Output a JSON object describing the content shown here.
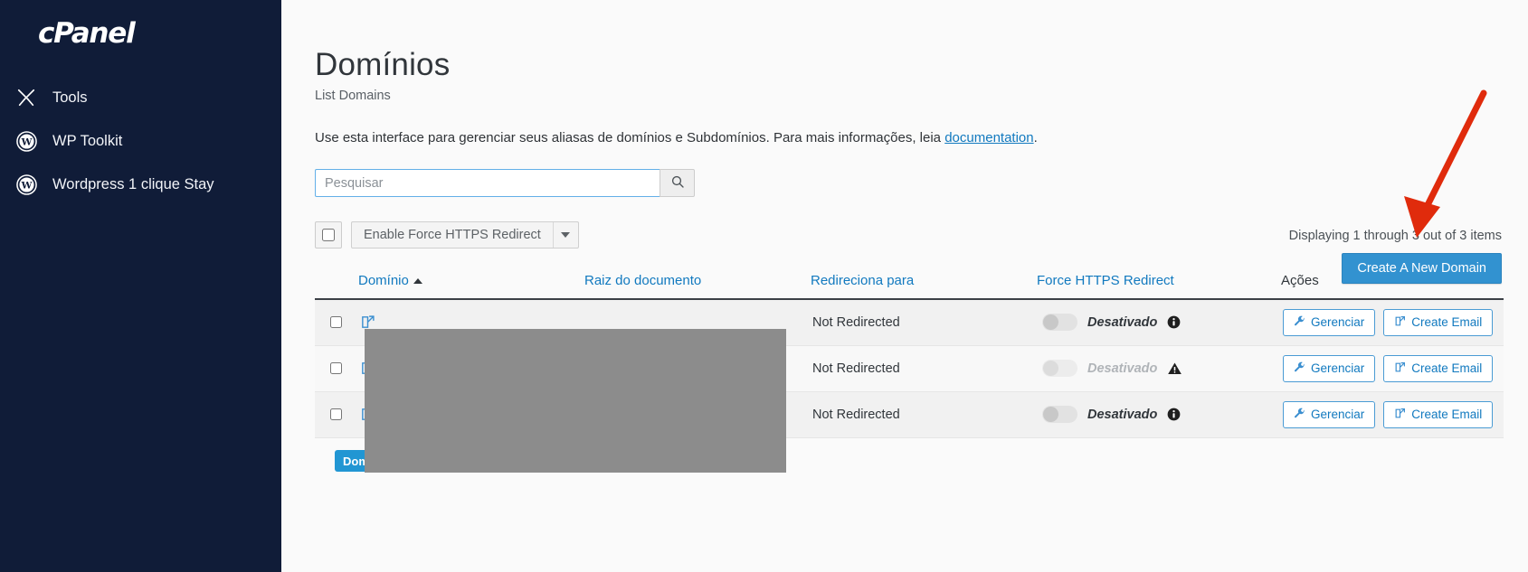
{
  "sidebar": {
    "brand": "cPanel",
    "items": [
      {
        "label": "Tools",
        "icon": "tools-icon"
      },
      {
        "label": "WP Toolkit",
        "icon": "wordpress-icon"
      },
      {
        "label": "Wordpress 1 clique Stay",
        "icon": "wordpress-icon"
      }
    ]
  },
  "page": {
    "title": "Domínios",
    "subtitle": "List Domains",
    "description_before": "Use esta interface para gerenciar seus aliasas de domínios e Subdomínios. Para mais informações, leia ",
    "description_link": "documentation",
    "description_after": "."
  },
  "search": {
    "placeholder": "Pesquisar",
    "value": "",
    "button_icon": "search-icon"
  },
  "toolbar": {
    "select_all_checked": false,
    "bulk_action_label": "Enable Force HTTPS Redirect",
    "caret_icon": "chevron-down-icon"
  },
  "summary": {
    "displaying_text": "Displaying 1 through 3 out of 3 items",
    "create_button_label": "Create A New Domain"
  },
  "table": {
    "columns": [
      {
        "key": "check",
        "label": ""
      },
      {
        "key": "domain",
        "label": "Domínio",
        "sorted": "asc"
      },
      {
        "key": "docroot",
        "label": "Raiz do documento"
      },
      {
        "key": "redirect",
        "label": "Redireciona para"
      },
      {
        "key": "https",
        "label": "Force HTTPS Redirect"
      },
      {
        "key": "actions",
        "label": "Ações"
      }
    ],
    "rows": [
      {
        "checked": false,
        "open_icon": "external-link-icon",
        "domain": "",
        "docroot": "",
        "redirect": "Not Redirected",
        "https_state": "Desativado",
        "https_enabled": false,
        "https_dimmed": false,
        "status_icon": "info-icon",
        "manage_label": "Gerenciar",
        "manage_icon": "wrench-icon",
        "email_label": "Create Email",
        "email_icon": "external-link-icon"
      },
      {
        "checked": false,
        "open_icon": "external-link-icon",
        "domain": "",
        "docroot": "",
        "redirect": "Not Redirected",
        "https_state": "Desativado",
        "https_enabled": false,
        "https_dimmed": true,
        "status_icon": "warning-icon",
        "manage_label": "Gerenciar",
        "manage_icon": "wrench-icon",
        "email_label": "Create Email",
        "email_icon": "external-link-icon"
      },
      {
        "checked": false,
        "open_icon": "external-link-icon",
        "domain": "",
        "docroot": "",
        "redirect": "Not Redirected",
        "https_state": "Desativado",
        "https_enabled": false,
        "https_dimmed": false,
        "status_icon": "info-icon",
        "manage_label": "Gerenciar",
        "manage_icon": "wrench-icon",
        "email_label": "Create Email",
        "email_icon": "external-link-icon"
      }
    ]
  },
  "overlays": {
    "redaction_note": "redacted-domain-names",
    "domain_badge_label": "Dom",
    "arrow_color": "#e02b0c"
  },
  "colors": {
    "sidebar_bg": "#101c38",
    "link": "#1179bf",
    "primary_button": "#3292d0",
    "badge": "#2196d3",
    "redaction": "#8c8c8c"
  }
}
